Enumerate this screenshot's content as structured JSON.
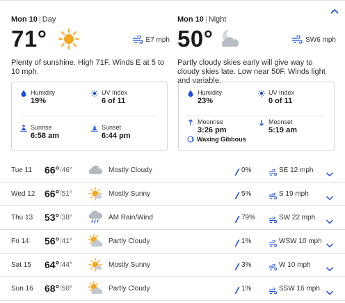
{
  "colors": {
    "accent": "#1b4de4",
    "sun": "#f5a623",
    "cloud": "#c3c7cf"
  },
  "day": {
    "date": "Mon 10",
    "period": "Day",
    "temp": "71°",
    "wind": "E7 mph",
    "narrative": "Plenty of sunshine. High 71F. Winds E at 5 to 10 mph.",
    "icon": "sun-icon",
    "details": {
      "humidity_label": "Humidity",
      "humidity": "19%",
      "uv_label": "UV Index",
      "uv": "6 of 11",
      "sunrise_label": "Sunrise",
      "sunrise": "6:58 am",
      "sunset_label": "Sunset",
      "sunset": "6:44 pm"
    }
  },
  "night": {
    "date": "Mon 10",
    "period": "Night",
    "temp": "50°",
    "wind": "SW6 mph",
    "narrative": "Partly cloudy skies early will give way to cloudy skies late. Low near 50F. Winds light and variable.",
    "icon": "moon-cloud-icon",
    "details": {
      "humidity_label": "Humidity",
      "humidity": "23%",
      "uv_label": "UV Index",
      "uv": "0 of 11",
      "moonrise_label": "Moonrise",
      "moonrise": "3:26 pm",
      "moonset_label": "Moonset",
      "moonset": "5:19 am",
      "moon_phase": "Waxing Gibbous"
    }
  },
  "forecast": [
    {
      "day": "Tue 11",
      "hi": "66°",
      "lo": "46°",
      "cond": "Mostly Cloudy",
      "icon": "cloud-icon",
      "precip": "0%",
      "wind": "SE 12 mph"
    },
    {
      "day": "Wed 12",
      "hi": "66°",
      "lo": "51°",
      "cond": "Mostly Sunny",
      "icon": "sun-icon",
      "precip": "5%",
      "wind": "S 19 mph"
    },
    {
      "day": "Thu 13",
      "hi": "53°",
      "lo": "38°",
      "cond": "AM Rain/Wind",
      "icon": "rain-icon",
      "precip": "79%",
      "wind": "SW 22 mph"
    },
    {
      "day": "Fri 14",
      "hi": "56°",
      "lo": "41°",
      "cond": "Partly Cloudy",
      "icon": "partly-cloudy-icon",
      "precip": "1%",
      "wind": "WSW 10 mph"
    },
    {
      "day": "Sat 15",
      "hi": "64°",
      "lo": "44°",
      "cond": "Mostly Sunny",
      "icon": "sun-icon",
      "precip": "3%",
      "wind": "W 10 mph"
    },
    {
      "day": "Sun 16",
      "hi": "68°",
      "lo": "50°",
      "cond": "Partly Cloudy",
      "icon": "partly-cloudy-icon",
      "precip": "1%",
      "wind": "SSW 16 mph"
    }
  ]
}
